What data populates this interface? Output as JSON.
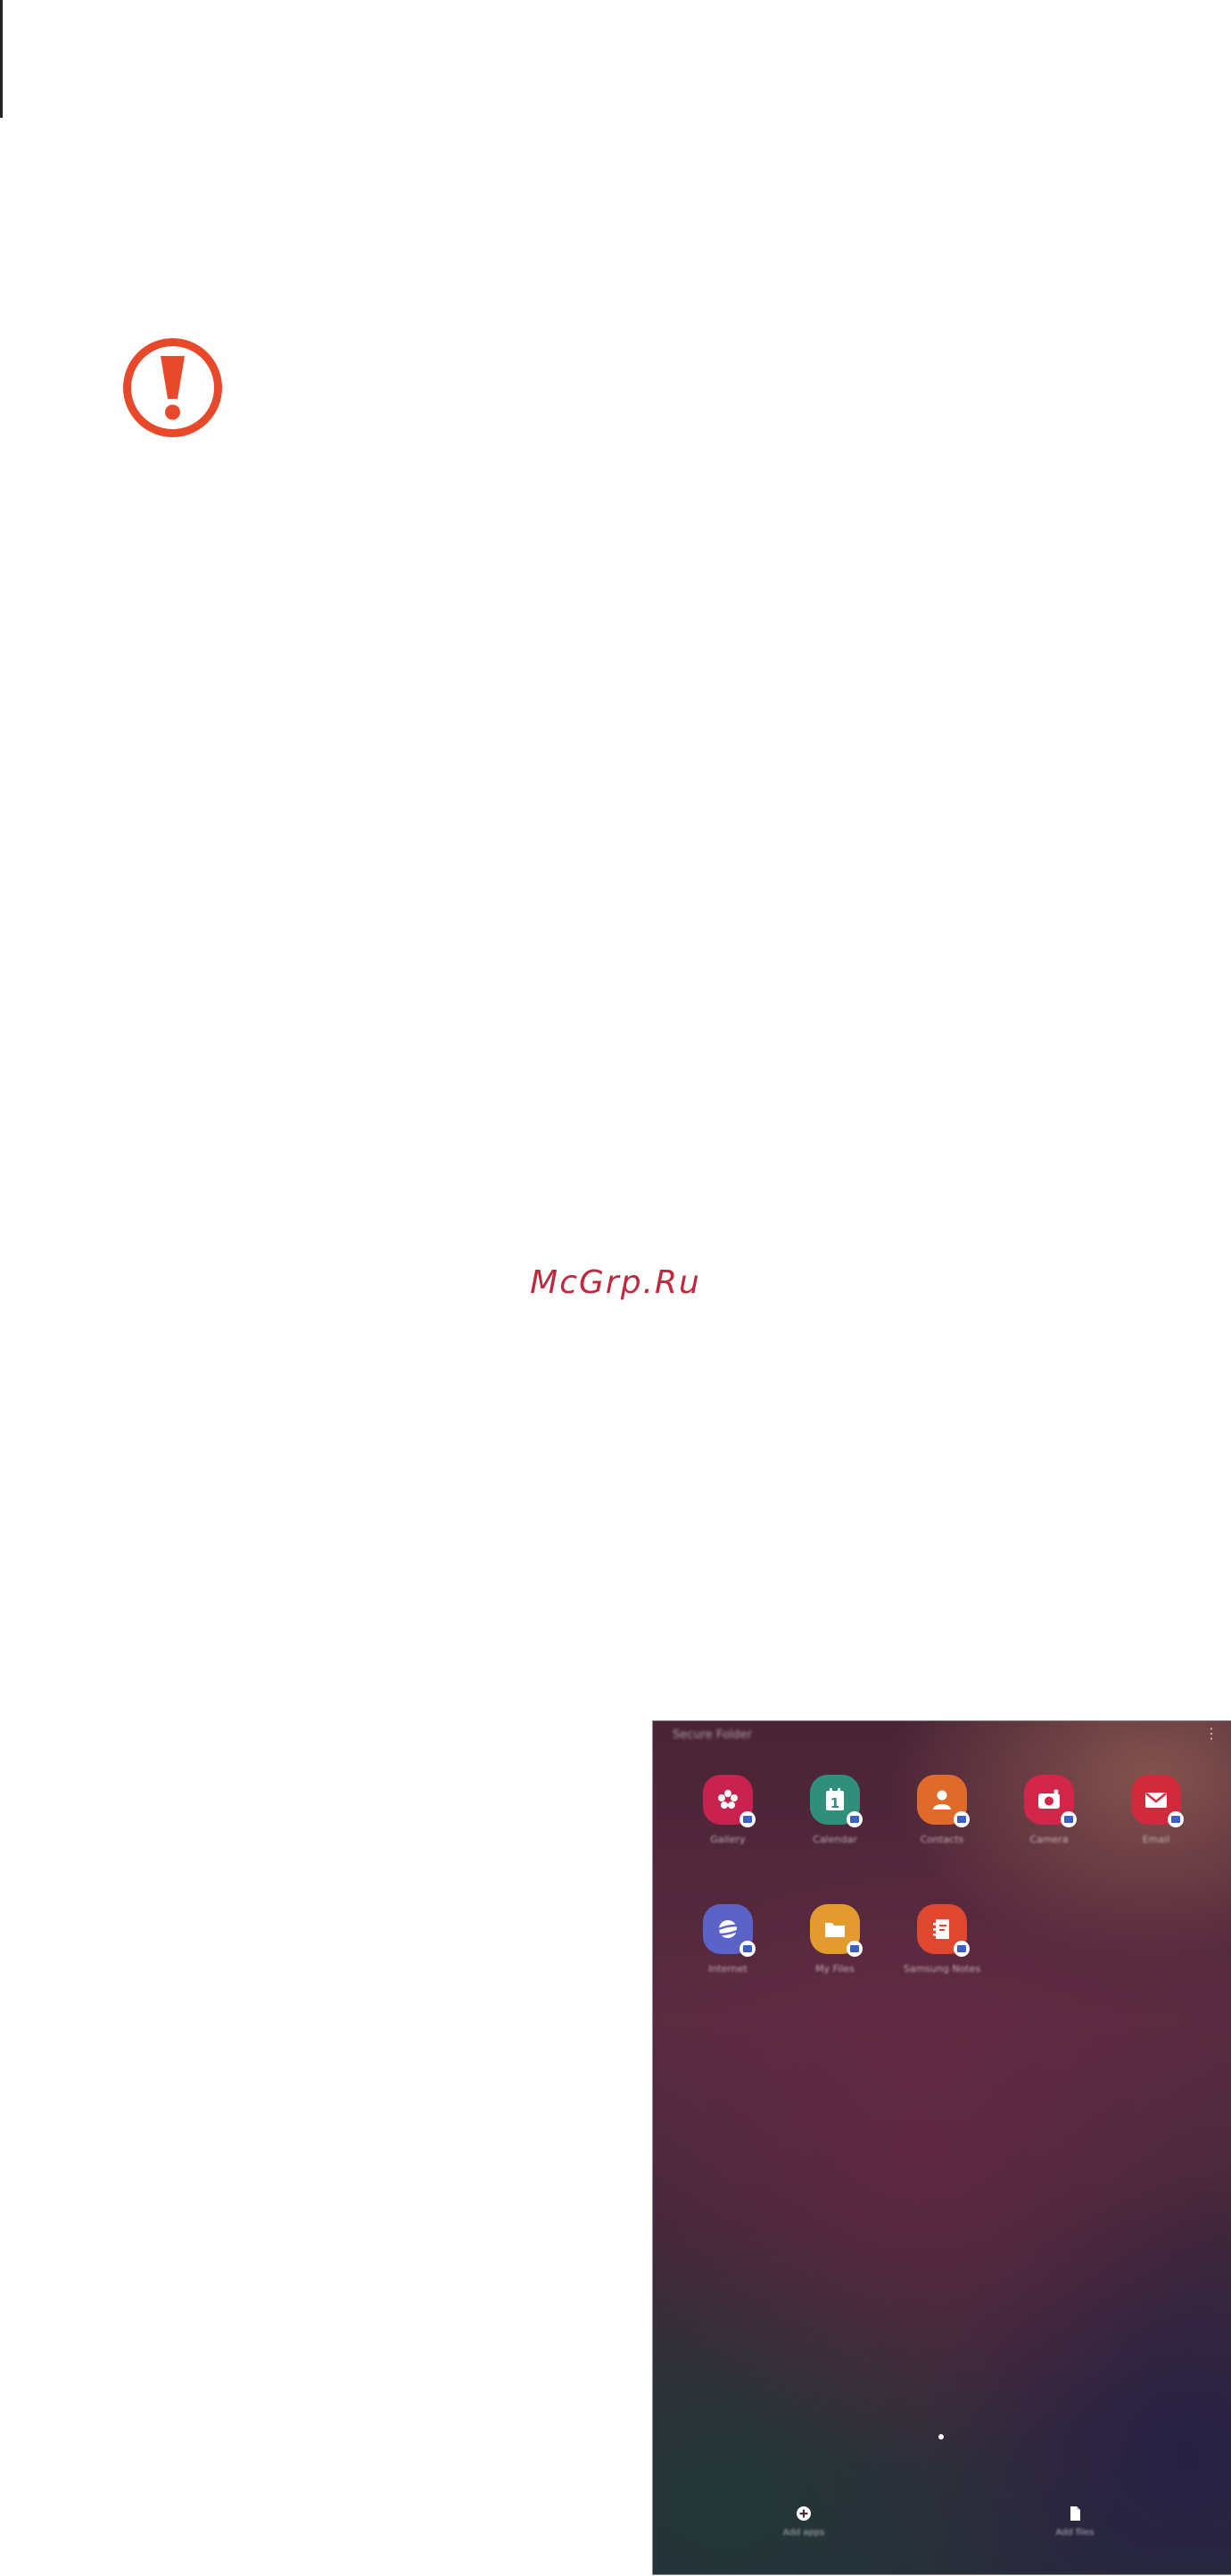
{
  "watermark": "McGrp.Ru",
  "colors": {
    "caution": "#e8492a",
    "watermark": "#c0283c",
    "badge": "#3d5fc4"
  },
  "icons": {
    "caution": "caution-icon",
    "more": "more-options-icon",
    "add_apps": "add-circle-icon",
    "add_files": "file-icon"
  },
  "secure_folder": {
    "title": "Secure Folder",
    "apps": [
      {
        "label": "Gallery",
        "color": "#c8234e",
        "icon": "gallery-icon"
      },
      {
        "label": "Calendar",
        "color": "#2f8f7a",
        "icon": "calendar-icon",
        "day": "1"
      },
      {
        "label": "Contacts",
        "color": "#e06a2c",
        "icon": "contacts-icon"
      },
      {
        "label": "Camera",
        "color": "#d3264b",
        "icon": "camera-icon"
      },
      {
        "label": "Email",
        "color": "#d12a3c",
        "icon": "email-icon"
      },
      {
        "label": "Internet",
        "color": "#5b63c9",
        "icon": "internet-icon"
      },
      {
        "label": "My Files",
        "color": "#e39a2e",
        "icon": "folder-icon"
      },
      {
        "label": "Samsung Notes",
        "color": "#e0472f",
        "icon": "notes-icon"
      }
    ],
    "bottom_actions": [
      {
        "label": "Add apps"
      },
      {
        "label": "Add files"
      }
    ]
  }
}
